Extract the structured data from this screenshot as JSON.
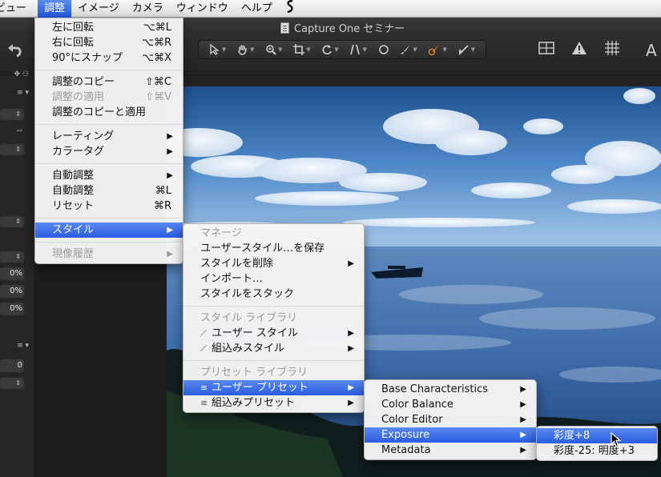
{
  "menubar": {
    "items": [
      {
        "label": "ビュー",
        "state": "truncated"
      },
      {
        "label": "調整",
        "state": "active"
      },
      {
        "label": "イメージ"
      },
      {
        "label": "カメラ"
      },
      {
        "label": "ウィンドウ"
      },
      {
        "label": "ヘルプ"
      }
    ],
    "script_icon": "script-icon"
  },
  "window": {
    "title": "Capture One セミナー"
  },
  "toolbar": {
    "tools": [
      "select-arrow-icon",
      "pan-hand-icon",
      "zoom-icon",
      "crop-icon",
      "rotate-icon",
      "keystone-icon",
      "circle-icon",
      "brush-icon",
      "eraser-icon",
      "picker-icon"
    ],
    "right_icons": [
      "grid-layout-icon",
      "warning-icon",
      "grid-icon",
      "text-icon"
    ]
  },
  "left_panel": {
    "values": [
      "--",
      "0%",
      "0%",
      "0%",
      "0"
    ]
  },
  "menu_adjust": {
    "items": [
      {
        "label": "左に回転",
        "shortcut": "⌥⌘L"
      },
      {
        "label": "右に回転",
        "shortcut": "⌥⌘R"
      },
      {
        "label": "90°にスナップ",
        "shortcut": "⌥⌘X"
      },
      {
        "sep": true
      },
      {
        "label": "調整のコピー",
        "shortcut": "⇧⌘C"
      },
      {
        "label": "調整の適用",
        "shortcut": "⇧⌘V",
        "disabled": true
      },
      {
        "label": "調整のコピーと適用"
      },
      {
        "sep": true
      },
      {
        "label": "レーティング",
        "submenu": true
      },
      {
        "label": "カラータグ",
        "submenu": true
      },
      {
        "sep": true
      },
      {
        "label": "自動調整",
        "submenu": true
      },
      {
        "label": "自動調整",
        "shortcut": "⌘L"
      },
      {
        "label": "リセット",
        "shortcut": "⌘R"
      },
      {
        "sep": true
      },
      {
        "label": "スタイル",
        "submenu": true,
        "highlighted": true
      },
      {
        "sep": true
      },
      {
        "label": "現像履歴",
        "submenu": true,
        "disabled": true
      }
    ]
  },
  "menu_style": {
    "items": [
      {
        "label": "マネージ",
        "header": true
      },
      {
        "label": "ユーザースタイル…を保存"
      },
      {
        "label": "スタイルを削除",
        "submenu": true
      },
      {
        "label": "インポート…"
      },
      {
        "label": "スタイルをスタック"
      },
      {
        "sep": true
      },
      {
        "label": "スタイル ライブラリ",
        "header": true
      },
      {
        "label": "ユーザー スタイル",
        "submenu": true,
        "glyph": "slash"
      },
      {
        "label": "組込みスタイル",
        "submenu": true,
        "glyph": "slash"
      },
      {
        "sep": true
      },
      {
        "label": "プリセット ライブラリ",
        "header": true
      },
      {
        "label": "ユーザー プリセット",
        "submenu": true,
        "glyph": "lines",
        "highlighted": true
      },
      {
        "label": "組込みプリセット",
        "submenu": true,
        "glyph": "lines"
      }
    ]
  },
  "menu_presets": {
    "items": [
      {
        "label": "Base Characteristics",
        "submenu": true
      },
      {
        "label": "Color Balance",
        "submenu": true
      },
      {
        "label": "Color Editor",
        "submenu": true
      },
      {
        "label": "Exposure",
        "submenu": true,
        "highlighted": true
      },
      {
        "label": "Metadata",
        "submenu": true
      }
    ]
  },
  "menu_exposure": {
    "items": [
      {
        "label": "彩度+8",
        "highlighted": true
      },
      {
        "label": "彩度-25: 明度+3"
      }
    ]
  },
  "colors": {
    "highlight": "#2a5de0",
    "menu_bg": "#f5f5f5",
    "chrome_dark": "#2c2c2c"
  }
}
